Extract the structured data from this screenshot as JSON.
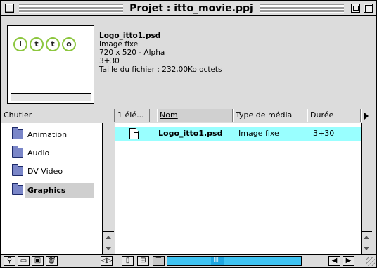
{
  "window": {
    "title": "Projet : itto_movie.ppj"
  },
  "preview": {
    "logo_letters": [
      "i",
      "t",
      "t",
      "o"
    ],
    "file_name": "Logo_itto1.psd",
    "type": "Image fixe",
    "dimensions": "720 x 520 - Alpha",
    "duration": "3+30",
    "size": "Taille du fichier : 232,00Ko octets"
  },
  "headers": {
    "bin": "Chutier",
    "count": "1 élé...",
    "name": "Nom",
    "media_type": "Type de média",
    "duration": "Durée"
  },
  "bins": [
    {
      "label": "Animation",
      "selected": false
    },
    {
      "label": "Audio",
      "selected": false
    },
    {
      "label": "DV Video",
      "selected": false
    },
    {
      "label": "Graphics",
      "selected": true
    }
  ],
  "items": [
    {
      "name": "Logo_itto1.psd",
      "media_type": "Image fixe",
      "duration": "3+30"
    }
  ],
  "colors": {
    "selection": "#99ffff",
    "scroll_accent": "#3fc3f2",
    "folder": "#7a86c8"
  },
  "toolbar_icons": [
    "find-icon",
    "new-bin-icon",
    "new-item-icon",
    "trash-icon",
    "expand-icon",
    "icon-view-icon",
    "thumbnail-view-icon",
    "list-view-icon"
  ]
}
